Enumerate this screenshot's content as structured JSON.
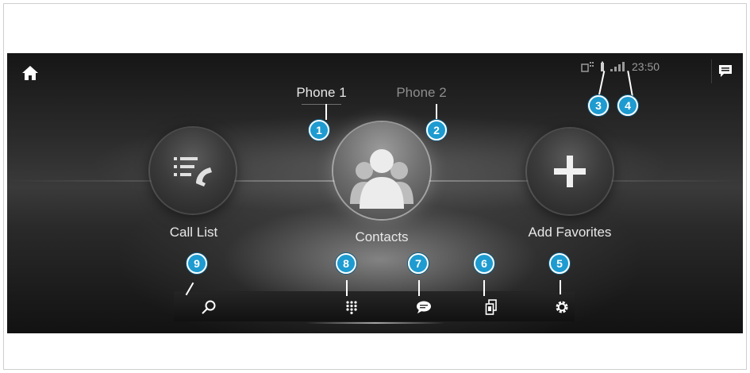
{
  "status": {
    "time": "23:50"
  },
  "phones": [
    {
      "label": "Phone 1",
      "active": true
    },
    {
      "label": "Phone 2",
      "active": false
    }
  ],
  "main_buttons": {
    "call_list": "Call List",
    "contacts": "Contacts",
    "add_favorites": "Add Favorites"
  },
  "toolbar": {
    "items": [
      "search-icon",
      "keypad-icon",
      "message-icon",
      "phone-transfer-icon",
      "settings-icon"
    ]
  },
  "callouts": [
    "1",
    "2",
    "3",
    "4",
    "5",
    "6",
    "7",
    "8",
    "9"
  ],
  "colors": {
    "callout": "#1e9bd0",
    "text": "#e8e8e8",
    "inactive_text": "#8d8d8d"
  }
}
